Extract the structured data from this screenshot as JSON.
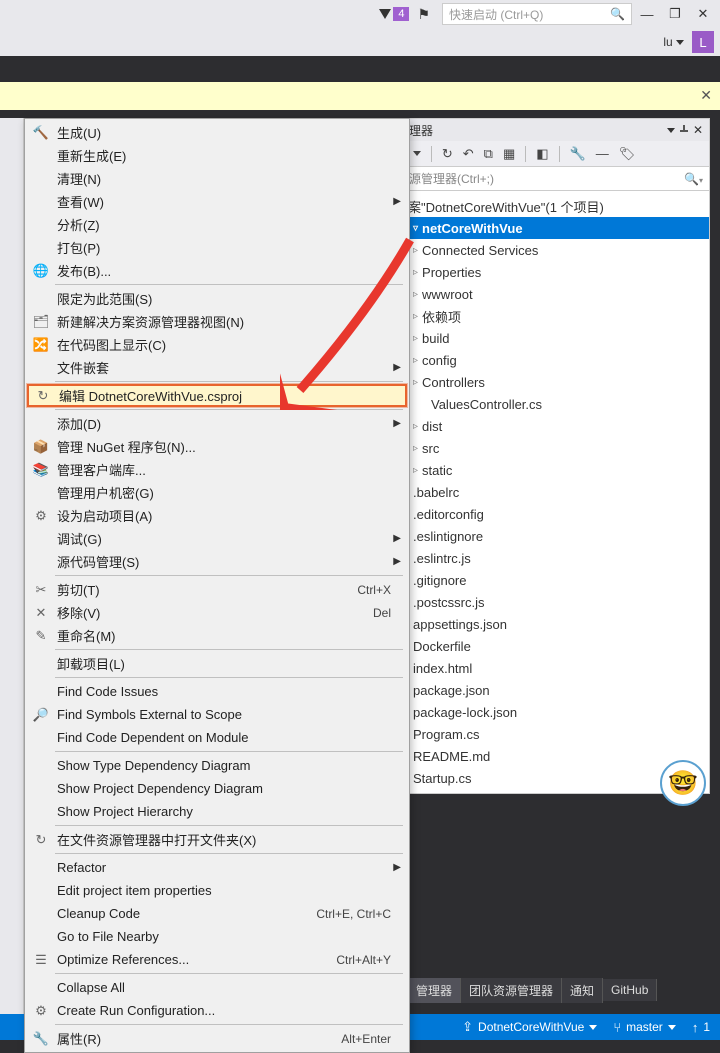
{
  "title_bar": {
    "filter_badge": "4",
    "quick_launch_placeholder": "快速启动 (Ctrl+Q)"
  },
  "second_bar": {
    "user": "lu",
    "avatar_letter": "L"
  },
  "solution_panel": {
    "title": "管理器",
    "search_placeholder": "资源管理器(Ctrl+;)",
    "solution_label": "案\"DotnetCoreWithVue\"(1 个项目)",
    "project_name": "netCoreWithVue",
    "items": [
      "Connected Services",
      "Properties",
      "wwwroot",
      "依赖项",
      "build",
      "config",
      "Controllers",
      "ValuesController.cs",
      "dist",
      "src",
      "static",
      ".babelrc",
      ".editorconfig",
      ".eslintignore",
      ".eslintrc.js",
      ".gitignore",
      ".postcssrc.js",
      "appsettings.json",
      "Dockerfile",
      "index.html",
      "package.json",
      "package-lock.json",
      "Program.cs",
      "README.md",
      "Startup.cs"
    ]
  },
  "context_menu": [
    {
      "icon": "build",
      "label": "生成(U)"
    },
    {
      "icon": "",
      "label": "重新生成(E)"
    },
    {
      "icon": "",
      "label": "清理(N)"
    },
    {
      "icon": "",
      "label": "查看(W)",
      "arrow": true
    },
    {
      "icon": "",
      "label": "分析(Z)"
    },
    {
      "icon": "",
      "label": "打包(P)"
    },
    {
      "icon": "publish",
      "label": "发布(B)...",
      "sep_after": true
    },
    {
      "icon": "",
      "label": "限定为此范围(S)"
    },
    {
      "icon": "newview",
      "label": "新建解决方案资源管理器视图(N)"
    },
    {
      "icon": "codemap",
      "label": "在代码图上显示(C)"
    },
    {
      "icon": "",
      "label": "文件嵌套",
      "arrow": true,
      "sep_after": true
    },
    {
      "icon": "edit",
      "label": "编辑 DotnetCoreWithVue.csproj",
      "highlight": true,
      "sep_after": true
    },
    {
      "icon": "",
      "label": "添加(D)",
      "arrow": true
    },
    {
      "icon": "nuget",
      "label": "管理 NuGet 程序包(N)..."
    },
    {
      "icon": "clientlib",
      "label": "管理客户端库..."
    },
    {
      "icon": "",
      "label": "管理用户机密(G)"
    },
    {
      "icon": "startup",
      "label": "设为启动项目(A)"
    },
    {
      "icon": "",
      "label": "调试(G)",
      "arrow": true
    },
    {
      "icon": "",
      "label": "源代码管理(S)",
      "arrow": true,
      "sep_after": true
    },
    {
      "icon": "cut",
      "label": "剪切(T)",
      "shortcut": "Ctrl+X"
    },
    {
      "icon": "delete",
      "label": "移除(V)",
      "shortcut": "Del"
    },
    {
      "icon": "rename",
      "label": "重命名(M)",
      "sep_after": true
    },
    {
      "icon": "",
      "label": "卸载项目(L)",
      "sep_after": true
    },
    {
      "icon": "",
      "label": "Find Code Issues"
    },
    {
      "icon": "findsym",
      "label": "Find Symbols External to Scope"
    },
    {
      "icon": "",
      "label": "Find Code Dependent on Module",
      "sep_after": true
    },
    {
      "icon": "",
      "label": "Show Type Dependency Diagram"
    },
    {
      "icon": "",
      "label": "Show Project Dependency Diagram"
    },
    {
      "icon": "",
      "label": "Show Project Hierarchy",
      "sep_after": true
    },
    {
      "icon": "openfolder",
      "label": "在文件资源管理器中打开文件夹(X)",
      "sep_after": true
    },
    {
      "icon": "",
      "label": "Refactor",
      "arrow": true
    },
    {
      "icon": "",
      "label": "Edit project item properties"
    },
    {
      "icon": "",
      "label": "Cleanup Code",
      "shortcut": "Ctrl+E, Ctrl+C"
    },
    {
      "icon": "",
      "label": "Go to File Nearby"
    },
    {
      "icon": "optimize",
      "label": "Optimize References...",
      "shortcut": "Ctrl+Alt+Y",
      "sep_after": true
    },
    {
      "icon": "",
      "label": "Collapse All"
    },
    {
      "icon": "runconfig",
      "label": "Create Run Configuration...",
      "sep_after": true
    },
    {
      "icon": "wrench",
      "label": "属性(R)",
      "shortcut": "Alt+Enter"
    }
  ],
  "bottom_tabs": [
    "管理器",
    "团队资源管理器",
    "通知",
    "GitHub"
  ],
  "status_bar": {
    "project": "DotnetCoreWithVue",
    "branch": "master",
    "sync_count": "1"
  }
}
